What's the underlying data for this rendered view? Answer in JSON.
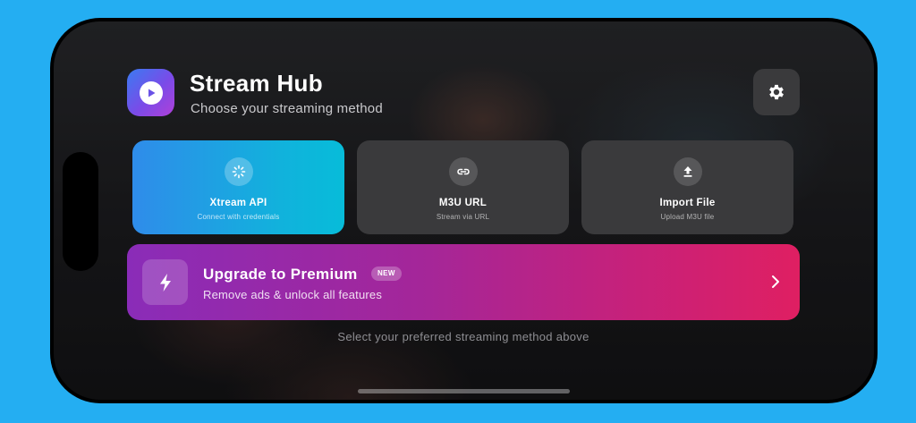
{
  "app": {
    "title": "Stream Hub",
    "subtitle": "Choose your streaming method",
    "icon": "play-icon",
    "settings_icon": "gear-icon"
  },
  "methods": [
    {
      "label": "Xtream API",
      "description": "Connect with credentials",
      "icon": "sparkle-icon",
      "active": true
    },
    {
      "label": "M3U URL",
      "description": "Stream via URL",
      "icon": "link-icon",
      "active": false
    },
    {
      "label": "Import File",
      "description": "Upload M3U file",
      "icon": "upload-icon",
      "active": false
    }
  ],
  "premium": {
    "title": "Upgrade to Premium",
    "badge": "NEW",
    "description": "Remove ads & unlock all features",
    "icon": "lightning-icon",
    "chevron_icon": "chevron-right-icon"
  },
  "hint": "Select your preferred streaming method above",
  "colors": {
    "background": "#24aef2",
    "card": "#3a3a3c",
    "active_card_start": "#2f8cea",
    "active_card_end": "#07bcd9",
    "premium_start": "#8a2cb8",
    "premium_end": "#df1f62"
  }
}
